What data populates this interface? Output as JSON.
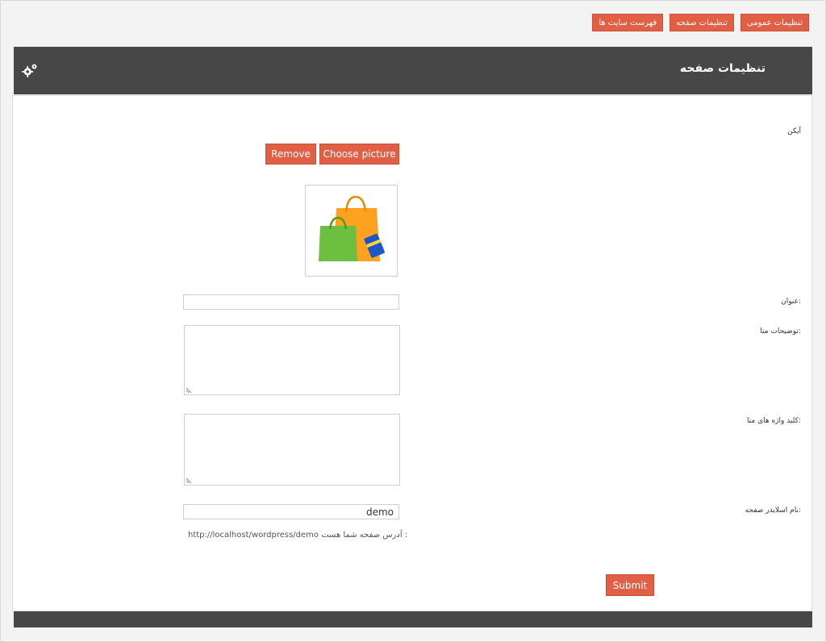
{
  "tabs": [
    {
      "label": "تنظیمات عمومی"
    },
    {
      "label": "تنظیمات صفحه"
    },
    {
      "label": "فهرست سایت ها"
    }
  ],
  "header": {
    "title": "تنظیمات صفحه",
    "icon": "gear-icon"
  },
  "form": {
    "icon_label": "آیکن",
    "remove_label": "Remove",
    "choose_label": "Choose picture",
    "title_label": "عنوان:",
    "title_value": "",
    "meta_desc_label": "توضیحات متا:",
    "meta_keywords_label": "کلید واژه های متا:",
    "slug_label": "نام اسلایدر صفحه:",
    "slug_value": "demo",
    "url_prefix": "آدرس صفحه شما هست :",
    "url_value": "http://localhost/wordpress/demo",
    "submit_label": "Submit"
  },
  "colors": {
    "accent": "#e15f45",
    "header": "#474747"
  }
}
